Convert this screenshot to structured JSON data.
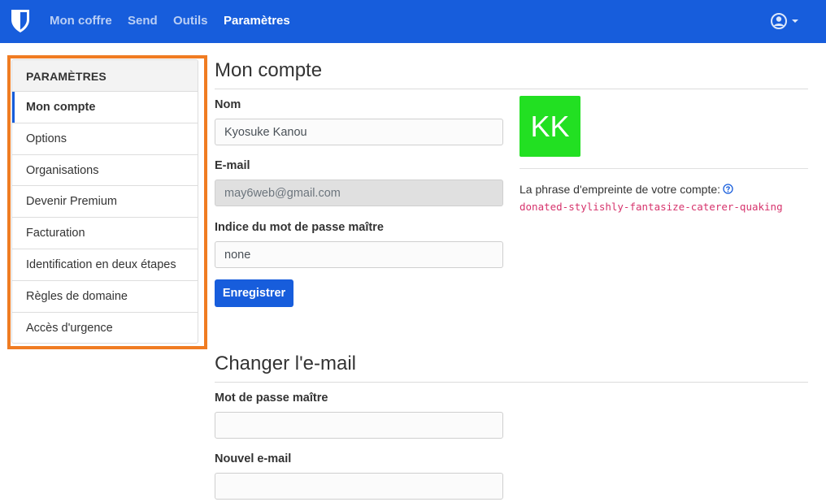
{
  "nav": {
    "items": [
      {
        "label": "Mon coffre",
        "active": false
      },
      {
        "label": "Send",
        "active": false
      },
      {
        "label": "Outils",
        "active": false
      },
      {
        "label": "Paramètres",
        "active": true
      }
    ],
    "colors": {
      "navbar": "#175ddc",
      "highlight": "#f07c22"
    }
  },
  "sidebar": {
    "header": "PARAMÈTRES",
    "items": [
      {
        "label": "Mon compte",
        "active": true
      },
      {
        "label": "Options",
        "active": false
      },
      {
        "label": "Organisations",
        "active": false
      },
      {
        "label": "Devenir Premium",
        "active": false
      },
      {
        "label": "Facturation",
        "active": false
      },
      {
        "label": "Identification en deux étapes",
        "active": false
      },
      {
        "label": "Règles de domaine",
        "active": false
      },
      {
        "label": "Accès d'urgence",
        "active": false
      }
    ]
  },
  "account": {
    "title": "Mon compte",
    "name_label": "Nom",
    "name_value": "Kyosuke Kanou",
    "email_label": "E-mail",
    "email_value": "may6web@gmail.com",
    "hint_label": "Indice du mot de passe maître",
    "hint_value": "none",
    "save_label": "Enregistrer",
    "avatar_initials": "KK",
    "avatar_color": "#22e022",
    "fingerprint_label": "La phrase d'empreinte de votre compte:",
    "fingerprint_phrase": "donated-stylishly-fantasize-caterer-quaking"
  },
  "change_email": {
    "title": "Changer l'e-mail",
    "master_password_label": "Mot de passe maître",
    "master_password_value": "",
    "new_email_label": "Nouvel e-mail",
    "new_email_value": ""
  },
  "icons": {
    "brand": "bitwarden-shield-icon",
    "account": "user-circle-icon",
    "help": "question-circle-icon"
  }
}
